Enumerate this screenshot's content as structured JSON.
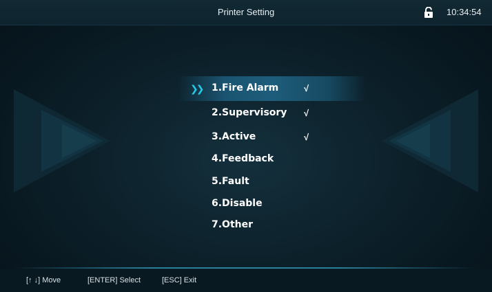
{
  "header": {
    "title": "Printer Setting",
    "clock": "10:34:54",
    "lock_icon": "lock-open-icon"
  },
  "menu": {
    "selected_index": 0,
    "selector_icon": "double-chevron-right-icon",
    "items": [
      {
        "label": "1.Fire Alarm",
        "checked": true,
        "check_mark": "√"
      },
      {
        "label": "2.Supervisory",
        "checked": true,
        "check_mark": "√"
      },
      {
        "label": "3.Active",
        "checked": true,
        "check_mark": "√"
      },
      {
        "label": "4.Feedback",
        "checked": false,
        "check_mark": ""
      },
      {
        "label": "5.Fault",
        "checked": false,
        "check_mark": ""
      },
      {
        "label": "6.Disable",
        "checked": false,
        "check_mark": ""
      },
      {
        "label": "7.Other",
        "checked": false,
        "check_mark": ""
      }
    ]
  },
  "footer": {
    "hints": [
      "[↑ ↓] Move",
      "[ENTER] Select",
      "[ESC] Exit"
    ]
  },
  "colors": {
    "accent": "#25c8e8",
    "highlight": "#1d5d7b",
    "background": "#0d222c"
  }
}
